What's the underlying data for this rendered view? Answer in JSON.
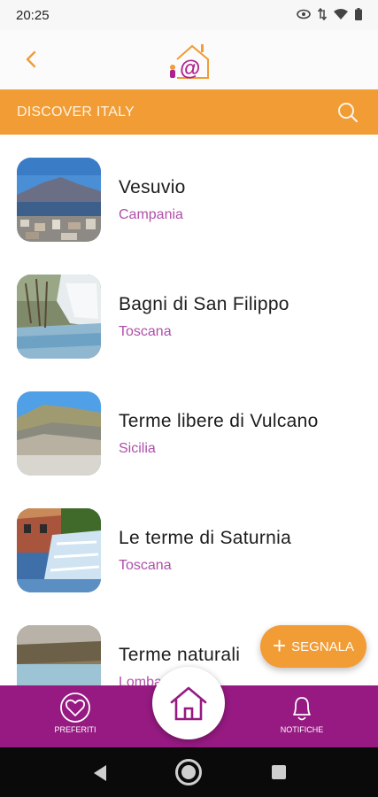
{
  "status": {
    "time": "20:25"
  },
  "header": {
    "logo": "cat-at-house-logo"
  },
  "titlebar": {
    "title": "DISCOVER ITALY"
  },
  "places": [
    {
      "name": "Vesuvio",
      "region": "Campania",
      "thumb": "volcano-bay-photo"
    },
    {
      "name": "Bagni di San Filippo",
      "region": "Toscana",
      "thumb": "white-travertine-falls-photo"
    },
    {
      "name": "Terme libere di Vulcano",
      "region": "Sicilia",
      "thumb": "rocky-coast-photo"
    },
    {
      "name": "Le terme di Saturnia",
      "region": "Toscana",
      "thumb": "mill-waterfall-photo"
    },
    {
      "name": "Terme naturali",
      "region": "Lombardia",
      "thumb": "thermal-pool-photo"
    }
  ],
  "fab": {
    "plus": "+",
    "label": "SEGNALA"
  },
  "bottom_nav": {
    "favorites": "PREFERITI",
    "notifications": "NOTIFICHE"
  },
  "colors": {
    "orange": "#f19c34",
    "purple": "#961a82",
    "region_text": "#b04fa9"
  }
}
